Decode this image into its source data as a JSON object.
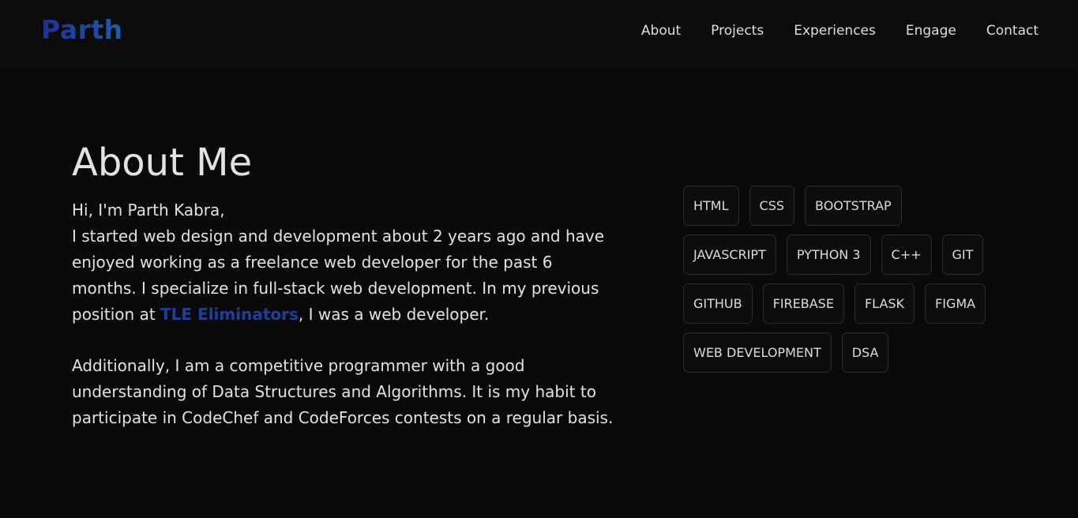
{
  "header": {
    "logo": "Parth",
    "nav": [
      "About",
      "Projects",
      "Experiences",
      "Engage",
      "Contact"
    ]
  },
  "about": {
    "title": "About Me",
    "greeting": "Hi, I'm Parth Kabra,",
    "para1_before": "I started web design and development about 2 years ago and have enjoyed working as a freelance web developer for the past 6 months. I specialize in full-stack web development. In my previous position at ",
    "company": "TLE Eliminators",
    "para1_after": ", I was a web developer.",
    "para2": "Additionally, I am a competitive programmer with a good understanding of Data Structures and Algorithms. It is my habit to participate in CodeChef and CodeForces contests on a regular basis."
  },
  "skills": [
    [
      "HTML",
      "CSS",
      "BOOTSTRAP"
    ],
    [
      "JAVASCRIPT",
      "PYTHON 3",
      "C++",
      "GIT"
    ],
    [
      "GITHUB",
      "FIREBASE",
      "FLASK",
      "FIGMA"
    ],
    [
      "WEB DEVELOPMENT",
      "DSA"
    ]
  ],
  "colors": {
    "background": "#0a0a0a",
    "logo_gradient_start": "#1d2f9a",
    "logo_gradient_end": "#1f5ca8",
    "link": "#1f3f9e",
    "text": "#e2e2e2"
  }
}
